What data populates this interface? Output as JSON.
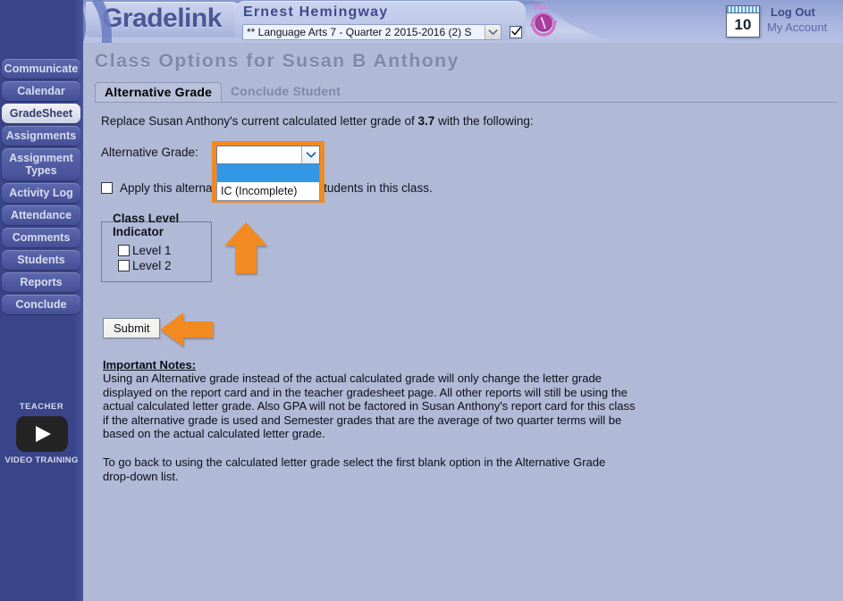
{
  "brand": {
    "name": "Gradelink",
    "logo_letter": "G"
  },
  "header": {
    "user_name": "Ernest Hemingway",
    "class_select_value": "** Language Arts 7 - Quarter 2 2015-2016 (2) S",
    "all_label": "ALL",
    "calendar_day": "10",
    "logout_label": "Log Out",
    "my_account_label": "My Account"
  },
  "sidebar": {
    "items": [
      {
        "label": "Communicate",
        "active": false
      },
      {
        "label": "Calendar",
        "active": false
      },
      {
        "label": "GradeSheet",
        "active": true
      },
      {
        "label": "Assignments",
        "active": false
      },
      {
        "label": "Assignment\nTypes",
        "active": false
      },
      {
        "label": "Activity Log",
        "active": false
      },
      {
        "label": "Attendance",
        "active": false
      },
      {
        "label": "Comments",
        "active": false
      },
      {
        "label": "Students",
        "active": false
      },
      {
        "label": "Reports",
        "active": false
      },
      {
        "label": "Conclude",
        "active": false
      }
    ],
    "video": {
      "title": "TEACHER",
      "subtitle": "VIDEO TRAINING"
    }
  },
  "main": {
    "page_title": "Class Options for Susan B Anthony",
    "tabs": [
      {
        "label": "Alternative Grade",
        "active": true
      },
      {
        "label": "Conclude Student",
        "active": false
      }
    ],
    "replace_prefix": "Replace Susan Anthony's current calculated letter grade of ",
    "replace_grade": "3.7",
    "replace_suffix": " with the following:",
    "alt_grade_label": "Alternative Grade:",
    "alt_grade_selected": "",
    "alt_grade_options": [
      "",
      "IC (Incomplete)"
    ],
    "apply_all_label": "Apply this alternative grade to all the students in this class.",
    "apply_all_checked": false,
    "class_level": {
      "title": "Class Level Indicator",
      "options": [
        {
          "label": "Level 1",
          "checked": false
        },
        {
          "label": "Level 2",
          "checked": false
        }
      ]
    },
    "submit_label": "Submit",
    "notes_title": "Important Notes:",
    "notes_body": "Using an Alternative grade instead of the actual calculated grade will only change the letter grade displayed on the report card and in the teacher gradesheet page. All other reports will still be using the actual calculated letter grade. Also GPA will not be factored in Susan Anthony's report card for this class if the alternative grade is used and Semester grades that are the average of two quarter terms will be based on the actual calculated letter grade.",
    "notes_body2": "To go back to using the calculated letter grade select the first blank option in the Alternative Grade drop-down list."
  },
  "colors": {
    "highlight_orange": "#f18a21",
    "sidebar_blue": "#3a4489",
    "page_bg": "#b0b9d6",
    "option_selected": "#3397e8"
  }
}
